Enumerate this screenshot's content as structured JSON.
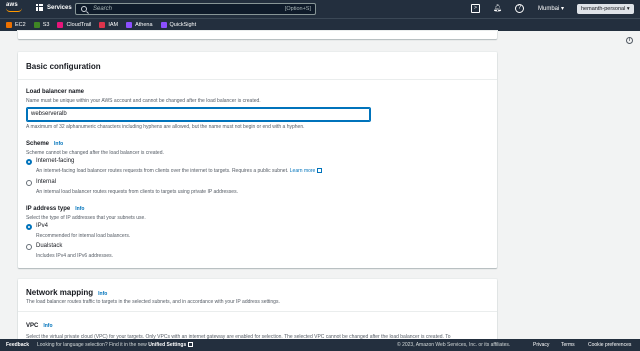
{
  "topnav": {
    "services_label": "Services",
    "search_placeholder": "Search",
    "search_shortcut": "[Option+S]",
    "region": "Mumbai ▾",
    "account": "hemanth-personal ▾"
  },
  "favorites": [
    {
      "label": "EC2",
      "color": "#ed7100"
    },
    {
      "label": "S3",
      "color": "#3f8624"
    },
    {
      "label": "CloudTrail",
      "color": "#e7157b"
    },
    {
      "label": "IAM",
      "color": "#dd344c"
    },
    {
      "label": "Athena",
      "color": "#8c4fff"
    },
    {
      "label": "QuickSight",
      "color": "#8c4fff"
    }
  ],
  "basic": {
    "title": "Basic configuration",
    "lb_name_label": "Load balancer name",
    "lb_name_desc": "Name must be unique within your AWS account and cannot be changed after the load balancer is created.",
    "lb_name_value": "webserveralb",
    "lb_name_hint": "A maximum of 32 alphanumeric characters including hyphens are allowed, but the name must not begin or end with a hyphen.",
    "scheme_label": "Scheme",
    "info": "Info",
    "scheme_desc": "Scheme cannot be changed after the load balancer is created.",
    "internet_label": "Internet-facing",
    "internet_desc": "An internet-facing load balancer routes requests from clients over the internet to targets. Requires a public subnet.",
    "learn_more": "Learn more",
    "internal_label": "Internal",
    "internal_desc": "An internal load balancer routes requests from clients to targets using private IP addresses.",
    "ip_label": "IP address type",
    "ip_desc": "Select the type of IP addresses that your subnets use.",
    "ipv4_label": "IPv4",
    "ipv4_desc": "Recommended for internal load balancers.",
    "dual_label": "Dualstack",
    "dual_desc": "Includes IPv4 and IPv6 addresses."
  },
  "network": {
    "title": "Network mapping",
    "info": "Info",
    "desc": "The load balancer routes traffic to targets in the selected subnets, and in accordance with your IP address settings.",
    "vpc_label": "VPC",
    "vpc_desc": "Select the virtual private cloud (VPC) for your targets. Only VPCs with an internet gateway are enabled for selection. The selected VPC cannot be changed after the load balancer is created. To"
  },
  "footer": {
    "feedback": "Feedback",
    "lang_text": "Looking for language selection? Find it in the new",
    "unified": "Unified Settings",
    "copyright": "© 2023, Amazon Web Services, Inc. or its affiliates.",
    "privacy": "Privacy",
    "terms": "Terms",
    "cookies": "Cookie preferences"
  }
}
